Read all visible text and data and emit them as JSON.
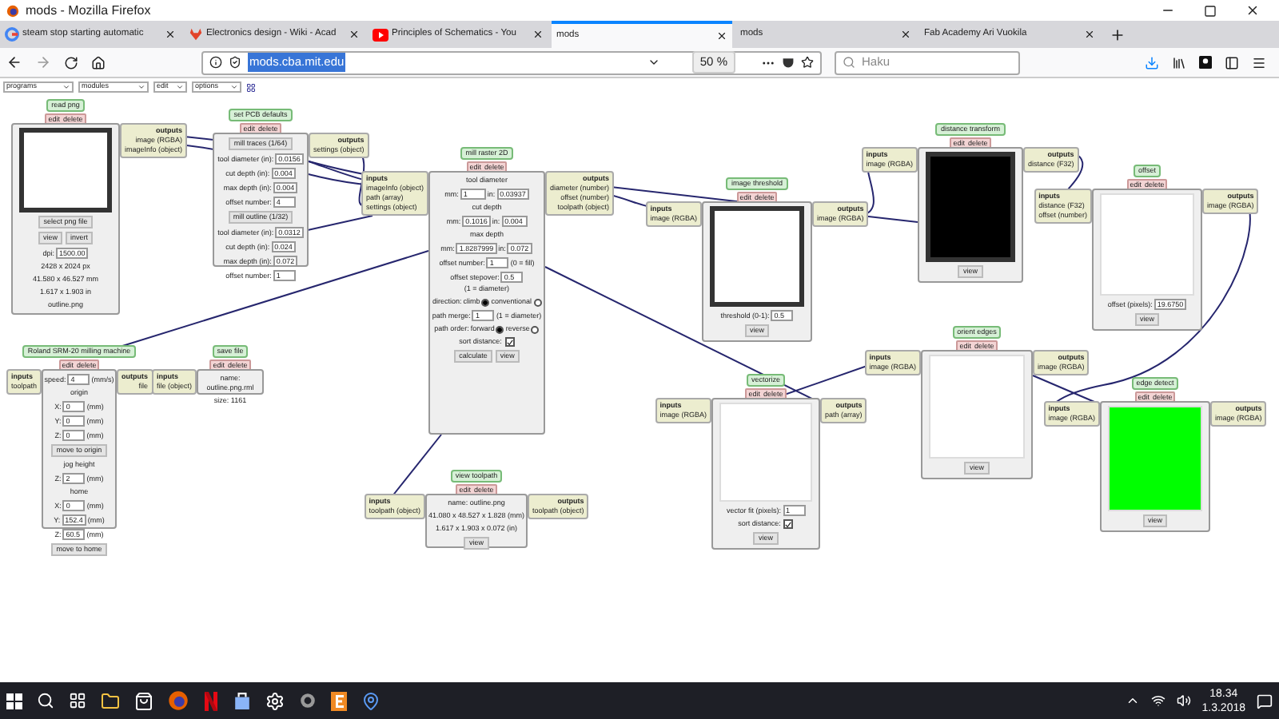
{
  "window": {
    "title": "mods - Mozilla Firefox"
  },
  "tabs": [
    {
      "label": "steam stop starting automatic",
      "selected": false
    },
    {
      "label": "Electronics design - Wiki - Acad",
      "selected": false
    },
    {
      "label": "Principles of Schematics - You",
      "selected": false
    },
    {
      "label": "mods",
      "selected": true
    },
    {
      "label": "mods",
      "selected": false
    },
    {
      "label": "Fab Academy Ari Vuokila",
      "selected": false
    }
  ],
  "address_bar": {
    "url": "mods.cba.mit.edu",
    "zoom": "50 %"
  },
  "search": {
    "placeholder": "Haku"
  },
  "menus": [
    "programs",
    "modules",
    "edit",
    "options"
  ],
  "modules": [
    {
      "title": "read png",
      "actions": [
        "edit",
        "delete"
      ],
      "outputs": {
        "heading": "outputs",
        "ports": [
          "image (RGBA)",
          "imageInfo (object)"
        ]
      },
      "items": [
        {
          "kind": "image",
          "color": "#ffffff",
          "frame": true
        },
        {
          "kind": "button",
          "label": "select png file"
        },
        {
          "kind": "buttons",
          "labels": [
            "view",
            "invert"
          ]
        },
        {
          "kind": "field",
          "label": "dpi:",
          "value": "1500.00"
        },
        {
          "kind": "text",
          "text": "2428 x 2024 px"
        },
        {
          "kind": "text",
          "text": "41.580 x 46.527 mm"
        },
        {
          "kind": "text",
          "text": "1.617 x 1.903 in"
        },
        {
          "kind": "text",
          "text": "outline.png"
        }
      ]
    },
    {
      "title": "set PCB defaults",
      "actions": [
        "edit",
        "delete"
      ],
      "outputs": {
        "heading": "outputs",
        "ports": [
          "settings (object)"
        ]
      },
      "items": [
        {
          "kind": "button",
          "label": "mill traces (1/64)"
        },
        {
          "kind": "field",
          "label": "tool diameter (in):",
          "value": "0.0156"
        },
        {
          "kind": "field",
          "label": "cut depth (in):",
          "value": "0.004"
        },
        {
          "kind": "field",
          "label": "max depth (in):",
          "value": "0.004"
        },
        {
          "kind": "field",
          "label": "offset number:",
          "value": "4"
        },
        {
          "kind": "button",
          "label": "mill outline (1/32)"
        },
        {
          "kind": "field",
          "label": "tool diameter (in):",
          "value": "0.0312"
        },
        {
          "kind": "field",
          "label": "cut depth (in):",
          "value": "0.024"
        },
        {
          "kind": "field",
          "label": "max depth (in):",
          "value": "0.072"
        },
        {
          "kind": "field",
          "label": "offset number:",
          "value": "1"
        }
      ]
    },
    {
      "title": "mill raster 2D",
      "actions": [
        "edit",
        "delete"
      ],
      "inputs": {
        "heading": "inputs",
        "ports": [
          "imageInfo (object)",
          "path (array)",
          "settings (object)"
        ]
      },
      "outputs": {
        "heading": "outputs",
        "ports": [
          "diameter (number)",
          "offset (number)",
          "toolpath (object)"
        ]
      },
      "items": [
        {
          "kind": "text",
          "text": "tool diameter"
        },
        {
          "kind": "pair",
          "label": "mm:",
          "value": "1",
          "label2": "in:",
          "value2": "0.03937"
        },
        {
          "kind": "text",
          "text": "cut depth"
        },
        {
          "kind": "pair",
          "label": "mm:",
          "value": "0.1016",
          "label2": "in:",
          "value2": "0.004"
        },
        {
          "kind": "text",
          "text": "max depth"
        },
        {
          "kind": "pair",
          "label": "mm:",
          "value": "1.8287999",
          "label2": "in:",
          "value2": "0.072"
        },
        {
          "kind": "field",
          "label": "offset number:",
          "value": "1",
          "unit": "(0 = fill)"
        },
        {
          "kind": "field",
          "label": "offset stepover:",
          "value": "0.5",
          "unit": "(1 = diameter)"
        },
        {
          "kind": "radio",
          "label": "direction:",
          "options": [
            {
              "label": "climb",
              "selected": true
            },
            {
              "label": "conventional",
              "selected": false
            }
          ]
        },
        {
          "kind": "field",
          "label": "path merge:",
          "value": "1",
          "unit": "(1 = diameter)"
        },
        {
          "kind": "radio",
          "label": "path order:",
          "options": [
            {
              "label": "forward",
              "selected": true
            },
            {
              "label": "reverse",
              "selected": false
            }
          ]
        },
        {
          "kind": "check",
          "label": "sort distance:",
          "checked": true
        },
        {
          "kind": "buttons",
          "labels": [
            "calculate",
            "view"
          ]
        }
      ]
    },
    {
      "title": "Roland SRM-20 milling machine",
      "actions": [
        "edit",
        "delete"
      ],
      "inputs": {
        "heading": "inputs",
        "ports": [
          "toolpath"
        ]
      },
      "outputs": {
        "heading": "outputs",
        "ports": [
          "file"
        ]
      },
      "items": [
        {
          "kind": "field",
          "label": "speed:",
          "value": "4",
          "unit": "(mm/s)"
        },
        {
          "kind": "text",
          "text": "origin"
        },
        {
          "kind": "field",
          "label": "X:",
          "value": "0",
          "unit": "(mm)"
        },
        {
          "kind": "field",
          "label": "Y:",
          "value": "0",
          "unit": "(mm)"
        },
        {
          "kind": "field",
          "label": "Z:",
          "value": "0",
          "unit": "(mm)"
        },
        {
          "kind": "button",
          "label": "move to origin"
        },
        {
          "kind": "text",
          "text": "jog height"
        },
        {
          "kind": "field",
          "label": "Z:",
          "value": "2",
          "unit": "(mm)"
        },
        {
          "kind": "text",
          "text": "home"
        },
        {
          "kind": "field",
          "label": "X:",
          "value": "0",
          "unit": "(mm)"
        },
        {
          "kind": "field",
          "label": "Y:",
          "value": "152.4",
          "unit": "(mm)"
        },
        {
          "kind": "field",
          "label": "Z:",
          "value": "60.5",
          "unit": "(mm)"
        },
        {
          "kind": "button",
          "label": "move to home"
        }
      ]
    },
    {
      "title": "save file",
      "actions": [
        "edit",
        "delete"
      ],
      "inputs": {
        "heading": "inputs",
        "ports": [
          "file (object)"
        ]
      },
      "items": [
        {
          "kind": "text",
          "text": "name: outline.png.rml"
        },
        {
          "kind": "text",
          "text": "size: 1161"
        }
      ]
    },
    {
      "title": "view toolpath",
      "actions": [
        "edit",
        "delete"
      ],
      "inputs": {
        "heading": "inputs",
        "ports": [
          "toolpath (object)"
        ]
      },
      "outputs": {
        "heading": "outputs",
        "ports": [
          "toolpath (object)"
        ]
      },
      "items": [
        {
          "kind": "text",
          "text": "name: outline.png"
        },
        {
          "kind": "text",
          "text": "41.080 x 48.527 x 1.828 (mm)"
        },
        {
          "kind": "text",
          "text": "1.617 x 1.903 x 0.072 (in)"
        },
        {
          "kind": "button",
          "label": "view"
        }
      ]
    },
    {
      "title": "image threshold",
      "actions": [
        "edit",
        "delete"
      ],
      "inputs": {
        "heading": "inputs",
        "ports": [
          "image (RGBA)"
        ]
      },
      "outputs": {
        "heading": "outputs",
        "ports": [
          "image (RGBA)"
        ]
      },
      "items": [
        {
          "kind": "image",
          "color": "#ffffff",
          "frame": true
        },
        {
          "kind": "field",
          "label": "threshold (0-1):",
          "value": "0.5"
        },
        {
          "kind": "button",
          "label": "view"
        }
      ]
    },
    {
      "title": "distance transform",
      "actions": [
        "edit",
        "delete"
      ],
      "inputs": {
        "heading": "inputs",
        "ports": [
          "image (RGBA)"
        ]
      },
      "outputs": {
        "heading": "outputs",
        "ports": [
          "distance (F32)"
        ]
      },
      "items": [
        {
          "kind": "image",
          "color": "#000000",
          "frame": true
        },
        {
          "kind": "button",
          "label": "view"
        }
      ]
    },
    {
      "title": "offset",
      "actions": [
        "edit",
        "delete"
      ],
      "inputs": {
        "heading": "inputs",
        "ports": [
          "distance (F32)",
          "offset (number)"
        ]
      },
      "outputs": {
        "heading": "outputs",
        "ports": [
          "image (RGBA)"
        ]
      },
      "items": [
        {
          "kind": "image",
          "color": "#ffffff",
          "frame": false
        },
        {
          "kind": "field",
          "label": "offset (pixels):",
          "value": "19.6750"
        },
        {
          "kind": "button",
          "label": "view"
        }
      ]
    },
    {
      "title": "vectorize",
      "actions": [
        "edit",
        "delete"
      ],
      "inputs": {
        "heading": "inputs",
        "ports": [
          "image (RGBA)"
        ]
      },
      "outputs": {
        "heading": "outputs",
        "ports": [
          "path (array)"
        ]
      },
      "items": [
        {
          "kind": "image",
          "color": "#ffffff",
          "frame": false
        },
        {
          "kind": "field",
          "label": "vector fit (pixels):",
          "value": "1"
        },
        {
          "kind": "check",
          "label": "sort distance:",
          "checked": true
        },
        {
          "kind": "button",
          "label": "view"
        }
      ]
    },
    {
      "title": "orient edges",
      "actions": [
        "edit",
        "delete"
      ],
      "inputs": {
        "heading": "inputs",
        "ports": [
          "image (RGBA)"
        ]
      },
      "outputs": {
        "heading": "outputs",
        "ports": [
          "image (RGBA)"
        ]
      },
      "items": [
        {
          "kind": "image",
          "color": "#ffffff",
          "frame": false
        },
        {
          "kind": "button",
          "label": "view"
        }
      ]
    },
    {
      "title": "edge detect",
      "actions": [
        "edit",
        "delete"
      ],
      "inputs": {
        "heading": "inputs",
        "ports": [
          "image (RGBA)"
        ]
      },
      "outputs": {
        "heading": "outputs",
        "ports": [
          "image (RGBA)"
        ]
      },
      "items": [
        {
          "kind": "image",
          "color": "#00ff00",
          "frame": false
        },
        {
          "kind": "button",
          "label": "view"
        }
      ]
    }
  ],
  "taskbar": {
    "time": "18.34",
    "date": "1.3.2018"
  }
}
